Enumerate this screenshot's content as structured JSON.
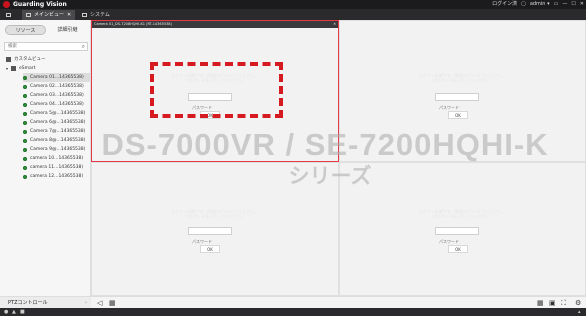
{
  "app": {
    "brand": "Guarding Vision",
    "right": [
      "ログイン済",
      "▢",
      "admin ▾",
      "▭",
      "—",
      "☐",
      "✕"
    ]
  },
  "tabs": [
    {
      "label": "メインビュー",
      "close": "✕"
    },
    {
      "label": "システム"
    }
  ],
  "sidebar": {
    "tabs": [
      "リソース",
      "詳細引継"
    ],
    "search_placeholder": "検索",
    "custom_view": "カスタムビュー",
    "group": "eSmart",
    "cameras": [
      "Camera 01...14365538)",
      "Camera 02...14365538)",
      "Camera 03...14365538)",
      "Camera 04...14365538)",
      "Camera 5@...14365538)",
      "Camera 6@...14365538)",
      "Camera 7@...14365538)",
      "Camera 8@...14365538)",
      "Camera 9@...14365538)",
      "camera 10...14365538)",
      "camera 11...14365538)",
      "camera 12...14365538)"
    ],
    "ptz": "PTZコントロール"
  },
  "grid": {
    "active_title": "Camera 01_DS-7208HQHI-K1 (RT-14365538)",
    "cell_message_line1": "ログイン失敗です。再度ログインしてください。",
    "cell_message_line2": "パスワードを入力してください。",
    "password_placeholder": "パスワード",
    "ok_label": "OK"
  },
  "watermark": {
    "line1": "DS-7000VR / SE-7200HQHI-K",
    "line2": "シリーズ"
  },
  "colors": {
    "accent_red": "#d51a22",
    "titlebar": "#1b1b1d",
    "online_green": "#2e9a3a"
  }
}
